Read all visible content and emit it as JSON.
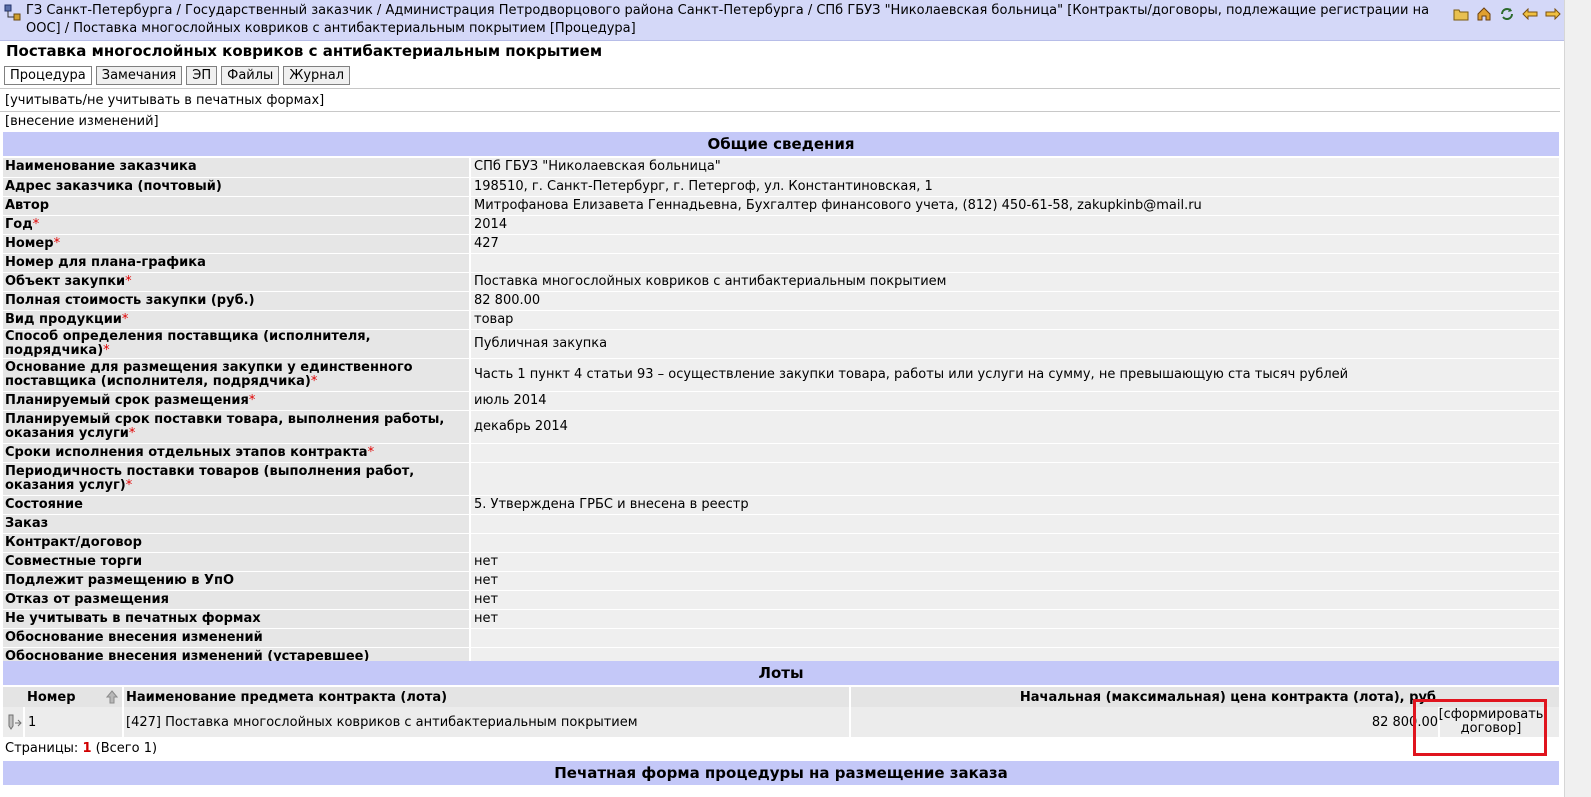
{
  "breadcrumb": "ГЗ Санкт-Петербурга / Государственный заказчик / Администрация Петродворцового района Санкт-Петербурга / СПб ГБУЗ \"Николаевская больница\" [Контракты/договоры, подлежащие регистрации на ООС] / Поставка многослойных ковриков с антибактериальным покрытием [Процедура]",
  "page_title": "Поставка многослойных ковриков с антибактериальным покрытием",
  "tabs": [
    "Процедура",
    "Замечания",
    "ЭП",
    "Файлы",
    "Журнал"
  ],
  "toolbar_icons": [
    "folder-icon",
    "home-icon",
    "refresh-icon",
    "back-arrow-icon",
    "forward-arrow-icon"
  ],
  "links": {
    "print_forms": "[учитывать/не учитывать в печатных формах]",
    "changes": "[внесение изменений]"
  },
  "sections": {
    "general": "Общие сведения",
    "lots": "Лоты",
    "print_form": "Печатная форма процедуры на размещение заказа"
  },
  "fields": [
    {
      "label": "Наименование заказчика",
      "required": false,
      "value": "СПб ГБУЗ \"Николаевская больница\""
    },
    {
      "label": "Адрес заказчика (почтовый)",
      "required": false,
      "value": "198510, г. Санкт-Петербург, г. Петергоф, ул. Константиновская, 1"
    },
    {
      "label": "Автор",
      "required": false,
      "value": "Митрофанова Елизавета Геннадьевна, Бухгалтер финансового учета, (812) 450-61-58, zakupkinb@mail.ru"
    },
    {
      "label": "Год",
      "required": true,
      "value": "2014"
    },
    {
      "label": "Номер",
      "required": true,
      "value": "427"
    },
    {
      "label": "Номер для плана-графика",
      "required": false,
      "value": ""
    },
    {
      "label": "Объект закупки",
      "required": true,
      "value": "Поставка многослойных ковриков с антибактериальным покрытием"
    },
    {
      "label": "Полная стоимость закупки (руб.)",
      "required": false,
      "value": "82 800.00"
    },
    {
      "label": "Вид продукции",
      "required": true,
      "value": "товар"
    },
    {
      "label": "Способ определения поставщика (исполнителя, подрядчика)",
      "required": true,
      "value": "Публичная закупка"
    },
    {
      "label": "Основание для размещения закупки у единственного поставщика (исполнителя, подрядчика)",
      "required": true,
      "value": "Часть 1 пункт 4 статьи 93 – осуществление закупки товара, работы или услуги на сумму, не превышающую ста тысяч рублей"
    },
    {
      "label": "Планируемый срок размещения",
      "required": true,
      "value": "июль 2014"
    },
    {
      "label": "Планируемый срок поставки товара, выполнения работы, оказания услуги",
      "required": true,
      "value": "декабрь 2014"
    },
    {
      "label": "Сроки исполнения отдельных этапов контракта",
      "required": true,
      "value": ""
    },
    {
      "label": "Периодичность поставки товаров (выполнения работ, оказания услуг)",
      "required": true,
      "value": ""
    },
    {
      "label": "Состояние",
      "required": false,
      "value": "5. Утверждена ГРБС и внесена в реестр"
    },
    {
      "label": "Заказ",
      "required": false,
      "value": ""
    },
    {
      "label": "Контракт/договор",
      "required": false,
      "value": ""
    },
    {
      "label": "Совместные торги",
      "required": false,
      "value": "нет"
    },
    {
      "label": "Подлежит размещению в УпО",
      "required": false,
      "value": "нет"
    },
    {
      "label": "Отказ от размещения",
      "required": false,
      "value": "нет"
    },
    {
      "label": "Не учитывать в печатных формах",
      "required": false,
      "value": "нет"
    },
    {
      "label": "Обоснование внесения изменений",
      "required": false,
      "value": ""
    },
    {
      "label": "Обоснование внесения изменений (устаревшее)",
      "required": false,
      "value": ""
    }
  ],
  "lots": {
    "columns": {
      "number": "Номер",
      "name": "Наименование предмета контракта (лота)",
      "price": "Начальная (максимальная) цена контракта (лота), руб"
    },
    "rows": [
      {
        "number": "1",
        "name": "[427] Поставка многослойных ковриков с антибактериальным покрытием",
        "price": "82 800.00",
        "action": "[сформировать договор]"
      }
    ]
  },
  "pagination": {
    "label": "Страницы:",
    "current": "1",
    "total": "(Всего 1)"
  },
  "colors": {
    "header_bar": "#d4d8f8",
    "section_header": "#c4c8f8",
    "required_mark": "#e00000",
    "highlight_box": "#e0141e"
  }
}
